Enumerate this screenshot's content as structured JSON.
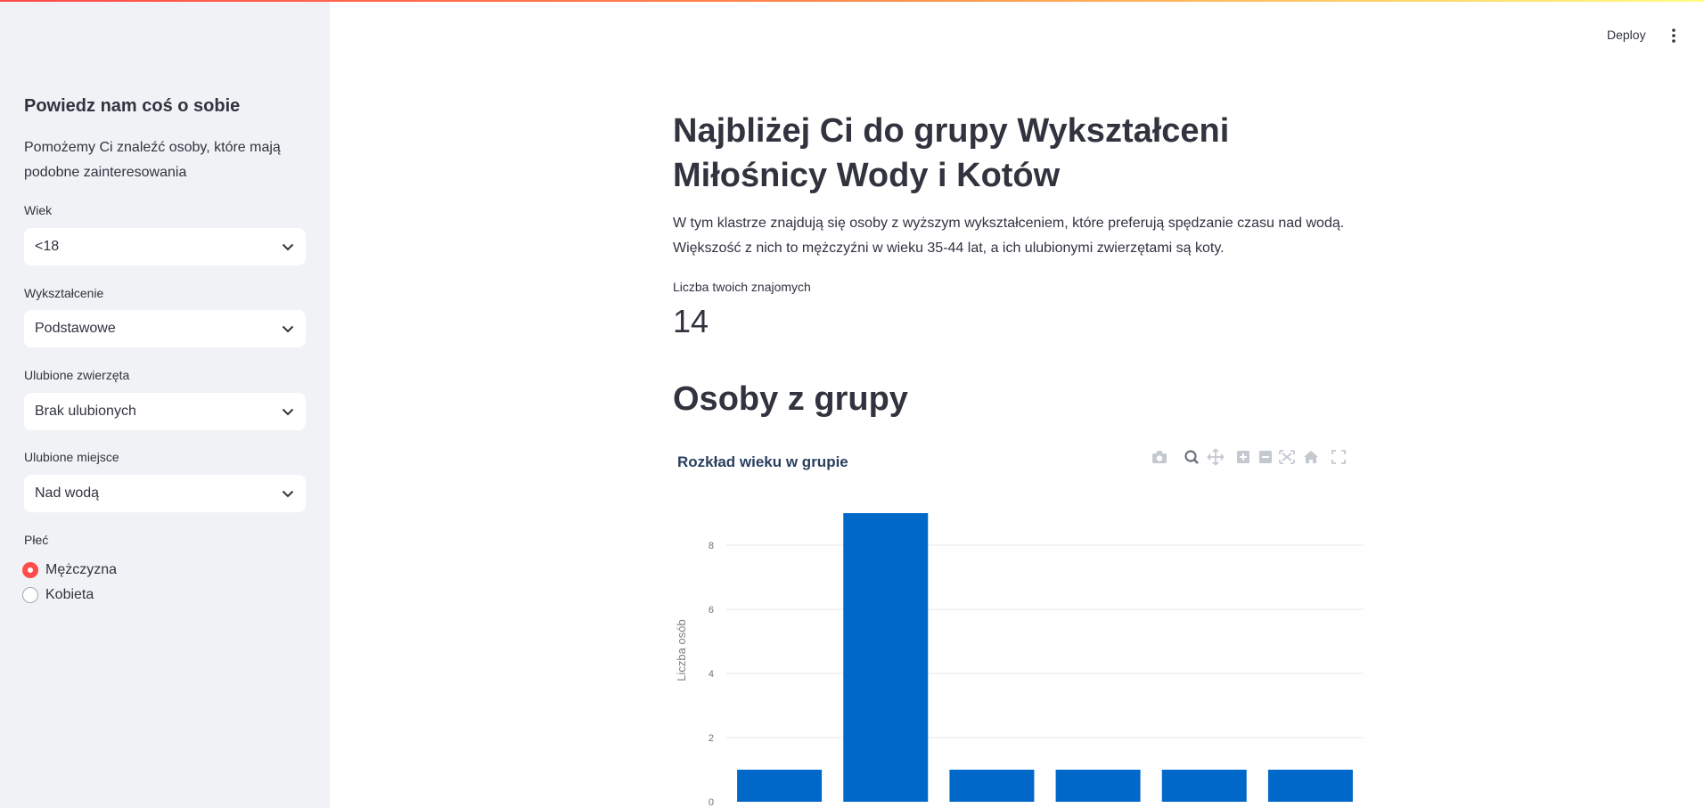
{
  "header": {
    "deploy_label": "Deploy"
  },
  "sidebar": {
    "title": "Powiedz nam coś o sobie",
    "description": "Pomożemy Ci znaleźć osoby, które mają podobne zainteresowania",
    "fields": {
      "age": {
        "label": "Wiek",
        "value": "<18"
      },
      "education": {
        "label": "Wykształcenie",
        "value": "Podstawowe"
      },
      "animals": {
        "label": "Ulubione zwierzęta",
        "value": "Brak ulubionych"
      },
      "place": {
        "label": "Ulubione miejsce",
        "value": "Nad wodą"
      },
      "gender": {
        "label": "Płeć",
        "options": [
          "Mężczyzna",
          "Kobieta"
        ],
        "selected": "Mężczyzna"
      }
    }
  },
  "main": {
    "title": "Najbliżej Ci do grupy Wykształceni Miłośnicy Wody i Kotów",
    "description": "W tym klastrze znajdują się osoby z wyższym wykształceniem, które preferują spędzanie czasu nad wodą. Większość z nich to mężczyźni w wieku 35-44 lat, a ich ulubionymi zwierzętami są koty.",
    "metric": {
      "label": "Liczba twoich znajomych",
      "value": "14"
    },
    "section_title": "Osoby z grupy"
  },
  "colors": {
    "accent": "#ff4b4b",
    "bar": "#0068c9",
    "sidebar_bg": "#f0f2f6"
  },
  "chart_data": {
    "type": "bar",
    "title": "Rozkład wieku w grupie",
    "xlabel": "",
    "ylabel": "Liczba osób",
    "values": [
      1,
      9,
      1,
      1,
      1,
      1
    ],
    "yticks": [
      0,
      2,
      4,
      6,
      8
    ],
    "ylim": [
      0,
      9.5
    ],
    "grid": true,
    "modebar_icons": [
      "camera-icon",
      "zoom-icon",
      "pan-icon",
      "zoom-in-icon",
      "zoom-out-icon",
      "autoscale-icon",
      "reset-axes-icon",
      "fullscreen-icon"
    ]
  }
}
